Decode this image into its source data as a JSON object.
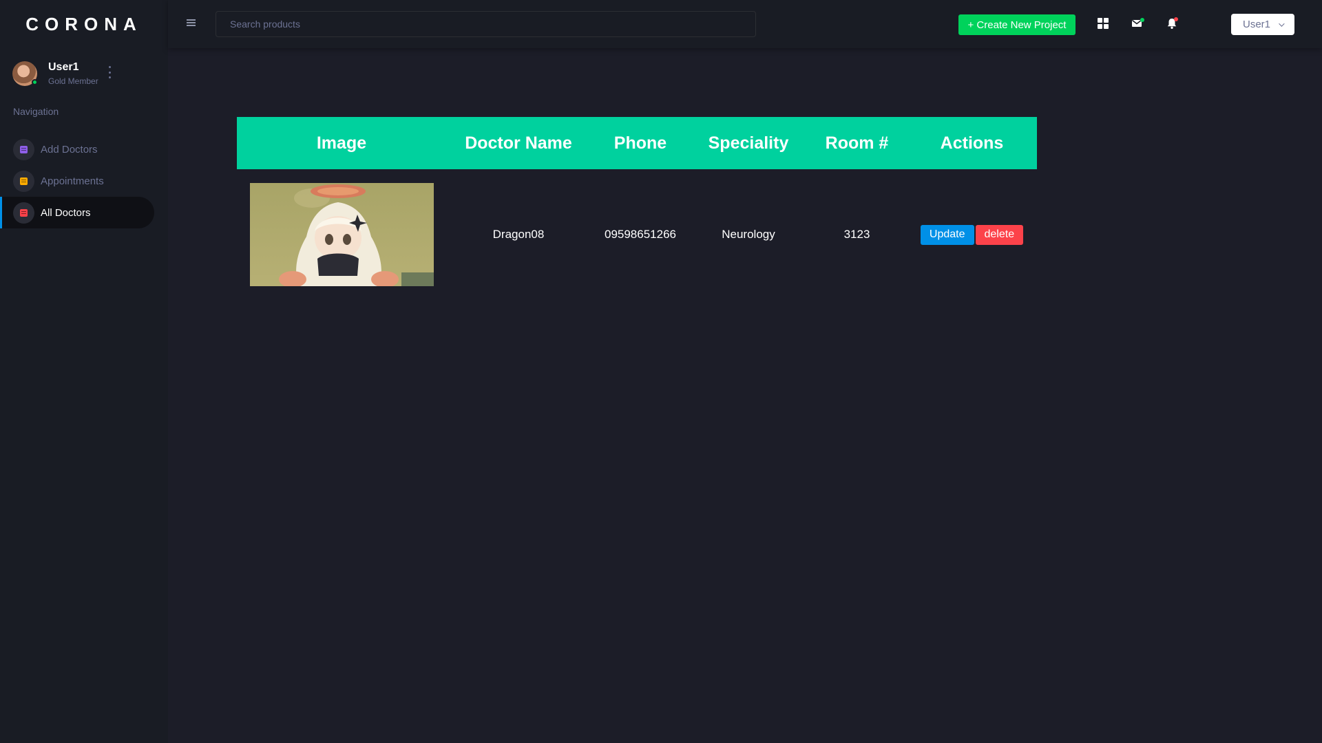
{
  "brand": "CORONA",
  "profile": {
    "name": "User1",
    "subtitle": "Gold Member"
  },
  "nav": {
    "title": "Navigation",
    "items": [
      {
        "label": "Add Doctors",
        "icon": "document-icon",
        "icon_color": "#8f5fe8",
        "active": false
      },
      {
        "label": "Appointments",
        "icon": "document-icon",
        "icon_color": "#ffab00",
        "active": false
      },
      {
        "label": "All Doctors",
        "icon": "document-icon",
        "icon_color": "#fc424a",
        "active": true
      }
    ]
  },
  "topbar": {
    "search_placeholder": "Search products",
    "create_label": "+ Create New Project",
    "user_label": "User1"
  },
  "table": {
    "headers": [
      "Image",
      "Doctor Name",
      "Phone",
      "Speciality",
      "Room #",
      "Actions"
    ],
    "rows": [
      {
        "image": "doctor-photo-anime-character",
        "name": "Dragon08",
        "phone": "09598651266",
        "speciality": "Neurology",
        "room": "3123",
        "update_label": "Update",
        "delete_label": "delete"
      }
    ]
  },
  "colors": {
    "accent": "#00d19e",
    "success": "#00d25b",
    "primary": "#0090e7",
    "danger": "#fc424a",
    "sidebar_bg": "#191c24",
    "page_bg": "#1c1d28"
  }
}
